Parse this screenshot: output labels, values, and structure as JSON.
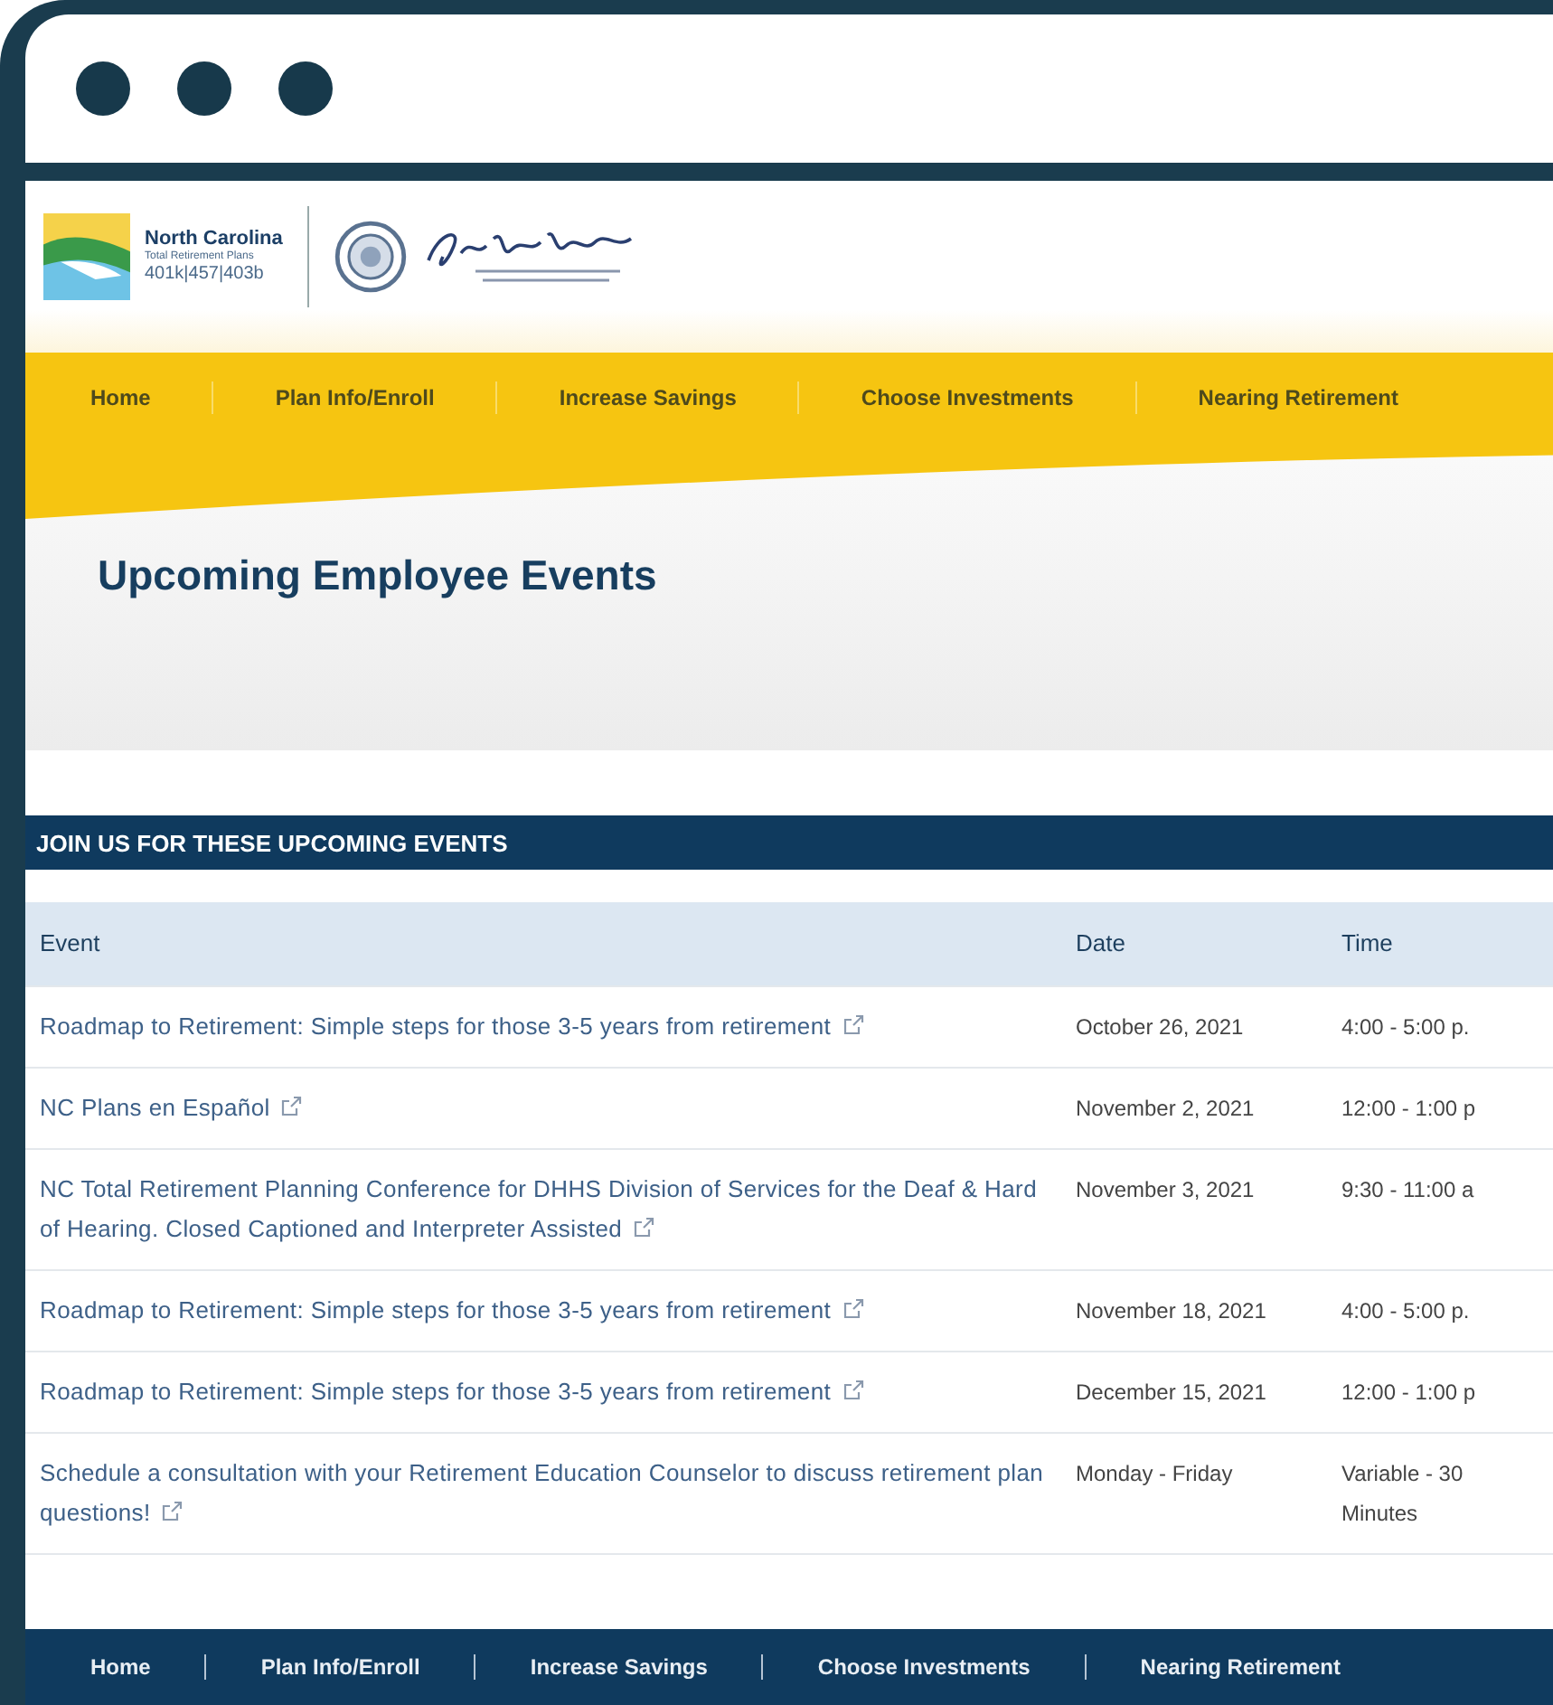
{
  "logo": {
    "title": "North Carolina",
    "subtitle": "Total Retirement Plans",
    "plans": "401k|457|403b"
  },
  "nav": [
    "Home",
    "Plan Info/Enroll",
    "Increase Savings",
    "Choose Investments",
    "Nearing Retirement"
  ],
  "hero": {
    "title": "Upcoming Employee Events"
  },
  "events": {
    "heading": "JOIN US FOR THESE UPCOMING EVENTS",
    "columns": [
      "Event",
      "Date",
      "Time"
    ],
    "rows": [
      {
        "event": "Roadmap to Retirement: Simple steps for those 3-5 years from retirement",
        "date": "October 26, 2021",
        "time": "4:00 - 5:00 p."
      },
      {
        "event": "NC Plans en Español",
        "date": "November 2, 2021",
        "time": "12:00 - 1:00 p"
      },
      {
        "event": "NC Total Retirement Planning Conference for DHHS Division of Services for the Deaf & Hard of Hearing. Closed Captioned and Interpreter Assisted",
        "date": "November 3, 2021",
        "time": "9:30 - 11:00 a"
      },
      {
        "event": "Roadmap to Retirement: Simple steps for those 3-5 years from retirement",
        "date": "November 18, 2021",
        "time": "4:00 - 5:00 p."
      },
      {
        "event": "Roadmap to Retirement: Simple steps for those 3-5 years from retirement",
        "date": "December 15, 2021",
        "time": "12:00 - 1:00 p"
      },
      {
        "event": "Schedule a consultation with your Retirement Education Counselor to discuss retirement plan questions!",
        "date": "Monday - Friday",
        "time": "Variable - 30 Minutes"
      }
    ]
  },
  "footer_nav": [
    "Home",
    "Plan Info/Enroll",
    "Increase Savings",
    "Choose Investments",
    "Nearing Retirement"
  ]
}
